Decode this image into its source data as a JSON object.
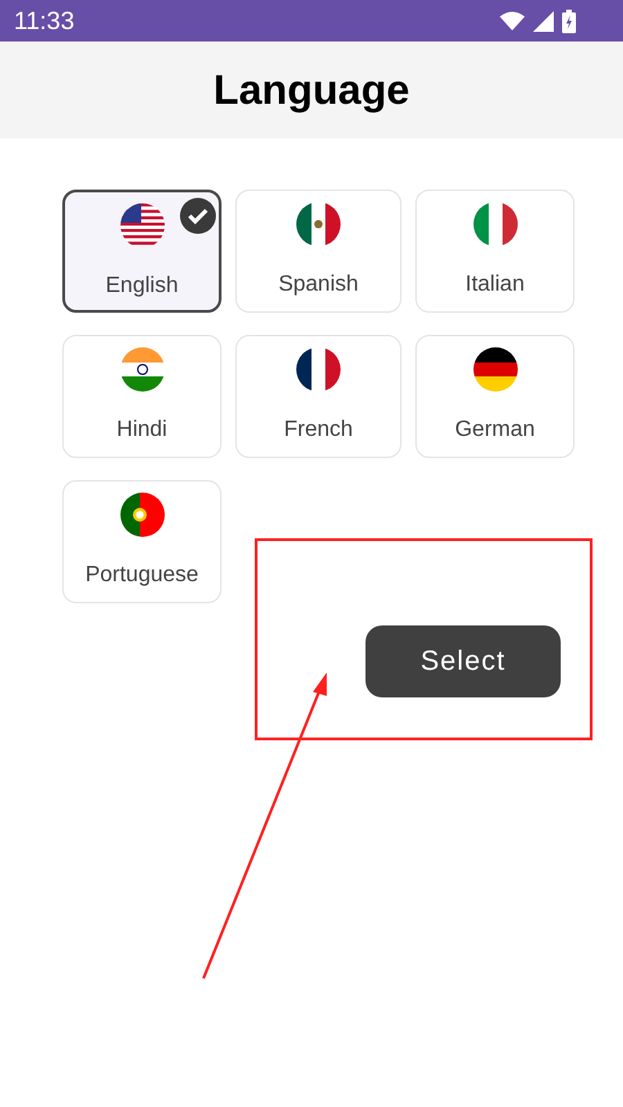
{
  "status_bar": {
    "time": "11:33"
  },
  "header": {
    "title": "Language"
  },
  "languages": [
    {
      "label": "English",
      "kind": "us",
      "selected": true
    },
    {
      "label": "Spanish",
      "kind": "mx",
      "selected": false
    },
    {
      "label": "Italian",
      "kind": "it",
      "selected": false
    },
    {
      "label": "Hindi",
      "kind": "in",
      "selected": false
    },
    {
      "label": "French",
      "kind": "fr",
      "selected": false
    },
    {
      "label": "German",
      "kind": "de",
      "selected": false
    },
    {
      "label": "Portuguese",
      "kind": "pt",
      "selected": false
    }
  ],
  "select_button": {
    "label": "Select"
  }
}
